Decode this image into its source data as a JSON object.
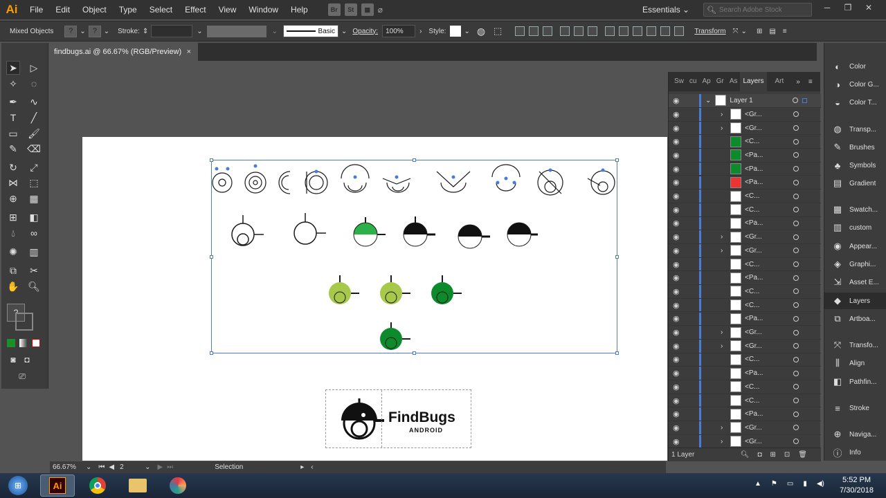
{
  "app": {
    "logo": "Ai",
    "accent": "#ff9a00"
  },
  "menu": [
    "File",
    "Edit",
    "Object",
    "Type",
    "Select",
    "Effect",
    "View",
    "Window",
    "Help"
  ],
  "menubar_badges": {
    "br": "Br",
    "st": "St"
  },
  "workspace": "Essentials",
  "stock_search": {
    "placeholder": "Search Adobe Stock"
  },
  "control": {
    "selection_type": "Mixed Objects",
    "stroke_label": "Stroke:",
    "brush_label": "Basic",
    "opacity_label": "Opacity:",
    "opacity_value": "100%",
    "style_label": "Style:",
    "transform_label": "Transform"
  },
  "document": {
    "tab_title": "findbugs.ai @ 66.67% (RGB/Preview)",
    "close": "×"
  },
  "status": {
    "zoom": "66.67%",
    "artboard_num": "2",
    "tool": "Selection"
  },
  "layers_panel": {
    "tabs": [
      "Sw",
      "cu",
      "Ap",
      "Gr",
      "As",
      "Layers",
      "Art"
    ],
    "top_layer": "Layer 1",
    "rows": [
      "<Gr...",
      "<Gr...",
      "<C...",
      "<Pa...",
      "<Pa...",
      "<Pa...",
      "<C...",
      "<C...",
      "<Pa...",
      "<Gr...",
      "<Gr...",
      "<C...",
      "<Pa...",
      "<C...",
      "<C...",
      "<Pa...",
      "<Gr...",
      "<Gr...",
      "<C...",
      "<Pa...",
      "<C...",
      "<C...",
      "<Pa...",
      "<Gr...",
      "<Gr..."
    ],
    "footer": "1 Layer"
  },
  "right_dock": [
    "Color",
    "Color G...",
    "Color T...",
    "Transp...",
    "Brushes",
    "Symbols",
    "Gradient",
    "Swatch...",
    "custom",
    "Appear...",
    "Graphi...",
    "Asset E...",
    "Layers",
    "Artboa...",
    "Transfo...",
    "Align",
    "Pathfin...",
    "Stroke",
    "Naviga...",
    "Info"
  ],
  "logo_artwork": {
    "title": "FindBugs",
    "subtitle": "ANDROID"
  },
  "taskbar": {
    "time": "5:52 PM",
    "date": "7/30/2018",
    "ai_label": "Ai"
  }
}
